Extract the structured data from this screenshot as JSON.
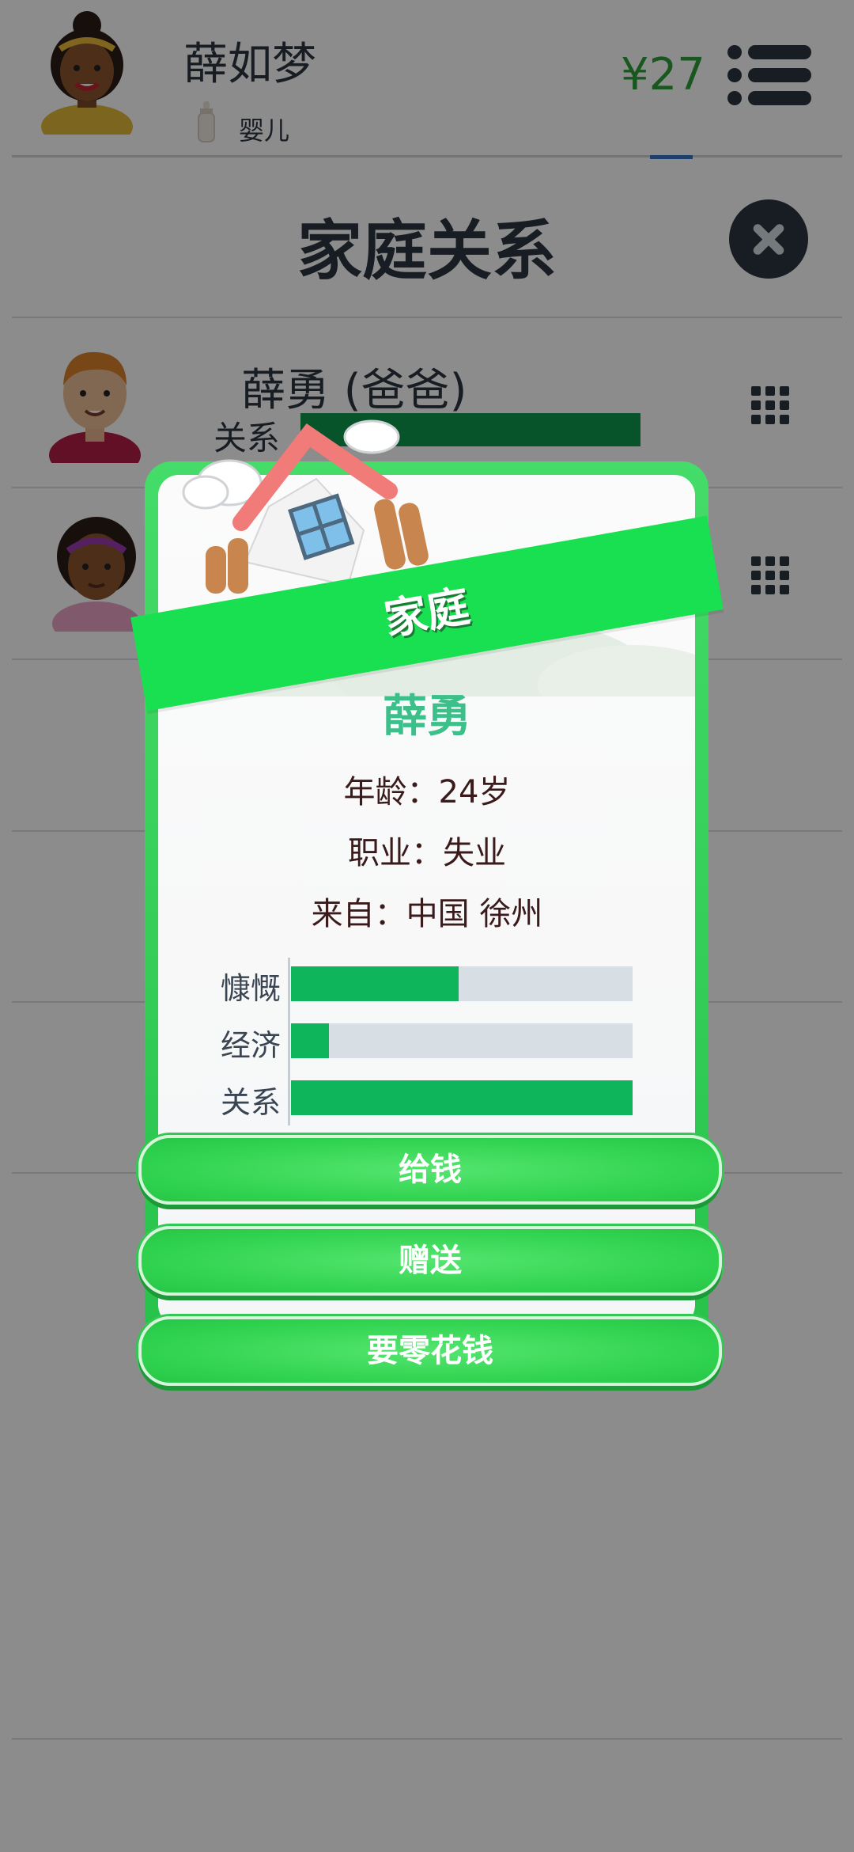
{
  "header": {
    "player_name": "薛如梦",
    "life_stage": "婴儿",
    "money": "¥27"
  },
  "page": {
    "title": "家庭关系",
    "members": [
      {
        "name": "薛勇 (爸爸)",
        "relation_label": "关系",
        "relation_level": 1.0
      }
    ]
  },
  "card": {
    "banner": "家庭",
    "person_name": "薛勇",
    "age": "年龄：24岁",
    "job": "职业：失业",
    "origin": "来自：中国 徐州",
    "stats": [
      {
        "label": "慷慨",
        "level": 0.49
      },
      {
        "label": "经济",
        "level": 0.11
      },
      {
        "label": "关系",
        "level": 1.0
      }
    ],
    "buttons": [
      "给钱",
      "赠送",
      "要零花钱"
    ]
  },
  "colors": {
    "accent_green": "#19e050",
    "bar_green": "#0fb55a",
    "money_green": "#2e9e3a"
  }
}
